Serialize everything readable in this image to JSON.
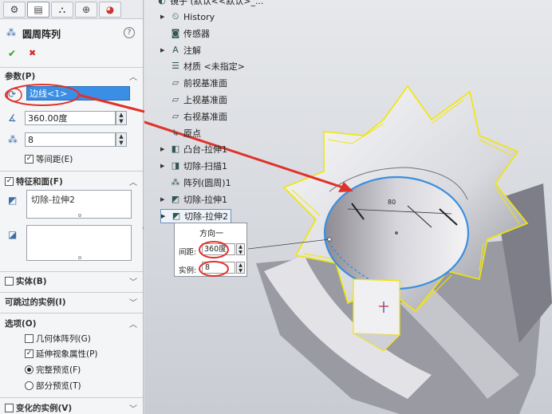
{
  "tabs": [
    {
      "icon": "feature-manager-icon",
      "glyph": "⚙"
    },
    {
      "icon": "property-manager-icon",
      "glyph": "▤"
    },
    {
      "icon": "configuration-manager-icon",
      "glyph": "⛬"
    },
    {
      "icon": "dimxpert-icon",
      "glyph": "⊕"
    },
    {
      "icon": "display-manager-icon",
      "glyph": "◕"
    }
  ],
  "header": {
    "title": "圆周阵列",
    "help": "?"
  },
  "actions": {
    "ok": "✔",
    "cancel": "✖"
  },
  "params": {
    "title": "参数(P)",
    "edge_value": "边线<1>",
    "angle_value": "360.00度",
    "count_value": "8",
    "equal_spacing": "等间距(E)"
  },
  "features": {
    "title": "特征和面(F)",
    "item": "切除-拉伸2"
  },
  "sections": {
    "solids": "实体(B)",
    "skip": "可跳过的实例(I)",
    "options": "选项(O)",
    "vary": "变化的实例(V)"
  },
  "options": {
    "geometry": "几何体阵列(G)",
    "propagate": "延伸视象属性(P)",
    "full_preview": "完整预览(F)",
    "partial_preview": "部分预览(T)"
  },
  "tree": {
    "top": "镜子 (默认<<默认>_...",
    "items": [
      {
        "label": "History",
        "arrow": "▶",
        "icon": "history-icon",
        "glyph": "⏲"
      },
      {
        "label": "传感器",
        "arrow": "",
        "icon": "sensor-icon",
        "glyph": "◙"
      },
      {
        "label": "注解",
        "arrow": "▶",
        "icon": "annotation-icon",
        "glyph": "A"
      },
      {
        "label": "材质 <未指定>",
        "arrow": "",
        "icon": "material-icon",
        "glyph": "☰"
      },
      {
        "label": "前视基准面",
        "arrow": "",
        "icon": "plane-icon",
        "glyph": "▱"
      },
      {
        "label": "上视基准面",
        "arrow": "",
        "icon": "plane-icon",
        "glyph": "▱"
      },
      {
        "label": "右视基准面",
        "arrow": "",
        "icon": "plane-icon",
        "glyph": "▱"
      },
      {
        "label": "原点",
        "arrow": "",
        "icon": "origin-icon",
        "glyph": "↳"
      },
      {
        "label": "凸台-拉伸1",
        "arrow": "▶",
        "icon": "boss-extrude-icon",
        "glyph": "◧"
      },
      {
        "label": "切除-扫描1",
        "arrow": "▶",
        "icon": "cut-sweep-icon",
        "glyph": "◨"
      },
      {
        "label": "阵列(圆周)1",
        "arrow": "",
        "icon": "circular-pattern-icon",
        "glyph": "⁂"
      },
      {
        "label": "切除-拉伸1",
        "arrow": "▶",
        "icon": "cut-extrude-icon",
        "glyph": "◩"
      },
      {
        "label": "切除-拉伸2",
        "arrow": "▶",
        "icon": "cut-extrude-icon",
        "glyph": "◩"
      }
    ]
  },
  "popup": {
    "title": "方向一",
    "spacing_label": "间距:",
    "spacing_value": "360度",
    "instance_label": "实例:",
    "instance_value": "8"
  },
  "dimension": {
    "label": "80"
  },
  "colors": {
    "accent": "#3b8fe0",
    "callout": "#e0322a",
    "edge": "#f2e600"
  }
}
